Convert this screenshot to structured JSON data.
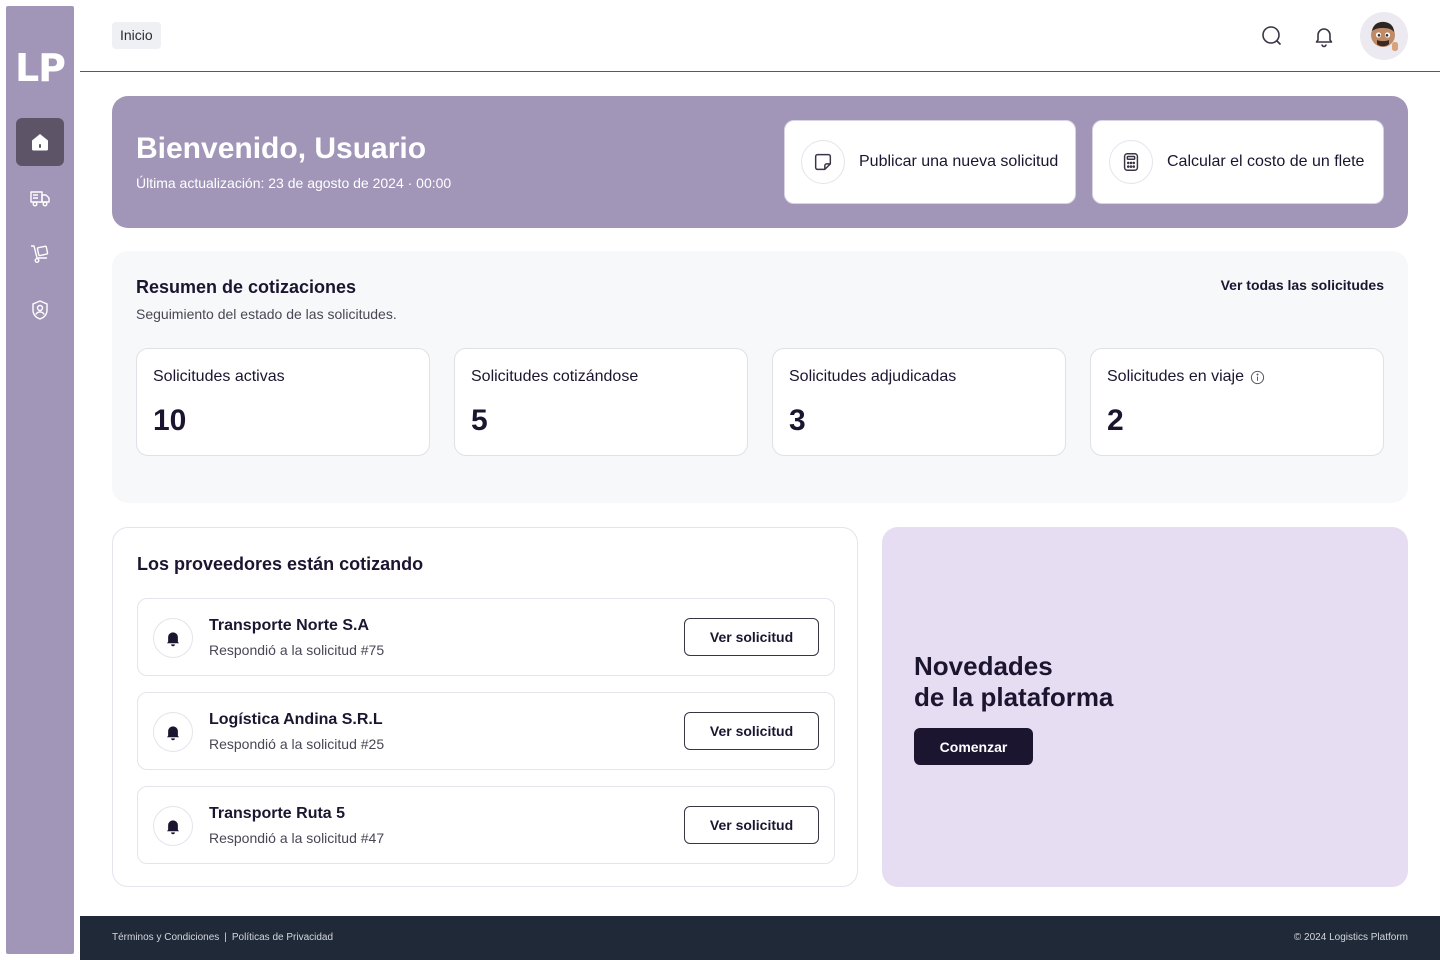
{
  "sidebar": {
    "logo": "LP",
    "items": [
      {
        "name": "home",
        "icon": "home-icon",
        "active": true
      },
      {
        "name": "shipments",
        "icon": "truck-icon",
        "active": false
      },
      {
        "name": "cargo",
        "icon": "hand-truck-icon",
        "active": false
      },
      {
        "name": "profile",
        "icon": "user-shield-icon",
        "active": false
      }
    ]
  },
  "header": {
    "breadcrumb": "Inicio",
    "icons": [
      "search-icon",
      "bell-icon",
      "avatar"
    ]
  },
  "welcome": {
    "title": "Bienvenido, Usuario",
    "subtitle": "Última actualización: 23 de agosto de 2024 · 00:00",
    "actions": [
      {
        "label": "Publicar una nueva solicitud",
        "icon": "note-icon"
      },
      {
        "label": "Calcular el costo de un flete",
        "icon": "calculator-icon"
      }
    ]
  },
  "summary": {
    "title": "Resumen de cotizaciones",
    "subtitle": "Seguimiento del estado de las solicitudes.",
    "link": "Ver todas las solicitudes",
    "stats": [
      {
        "label": "Solicitudes activas",
        "value": "10"
      },
      {
        "label": "Solicitudes cotizándose",
        "value": "5"
      },
      {
        "label": "Solicitudes adjudicadas",
        "value": "3"
      },
      {
        "label": "Solicitudes en viaje",
        "value": "2",
        "info": true
      }
    ]
  },
  "providers": {
    "title": "Los proveedores están cotizando",
    "button_label": "Ver solicitud",
    "items": [
      {
        "name": "Transporte Norte S.A",
        "desc": "Respondió a la solicitud #75"
      },
      {
        "name": "Logística Andina S.R.L",
        "desc": "Respondió a la solicitud #25"
      },
      {
        "name": "Transporte Ruta 5",
        "desc": "Respondió a la solicitud #47"
      }
    ]
  },
  "news": {
    "title_line1": "Novedades",
    "title_line2": "de la plataforma",
    "button": "Comenzar"
  },
  "footer": {
    "terms": "Términos y Condiciones",
    "separator": "|",
    "privacy": "Políticas de Privacidad",
    "copyright": "© 2024 Logistics Platform"
  },
  "colors": {
    "sidebar": "#a196b8",
    "accent_dark": "#1c1530",
    "news_bg": "#e7ddf3",
    "footer_bg": "#1f2937"
  }
}
